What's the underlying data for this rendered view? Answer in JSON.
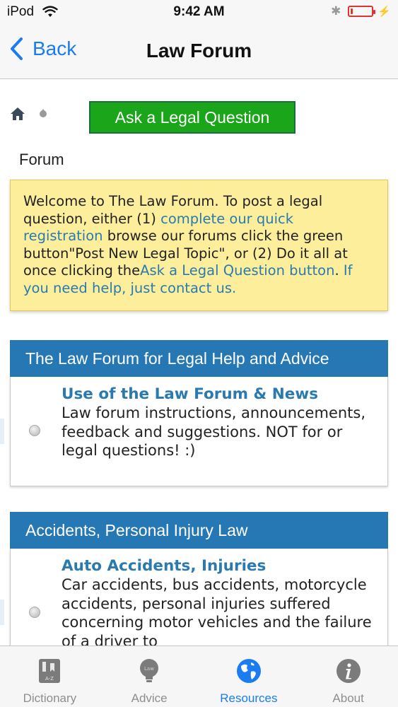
{
  "status_bar": {
    "carrier": "iPod",
    "time": "9:42 AM",
    "icons": [
      "wifi-icon",
      "bluetooth-icon",
      "battery-icon",
      "charging-icon"
    ],
    "battery_level": 0.12
  },
  "nav": {
    "back_label": "Back",
    "title": "Law Forum"
  },
  "breadcrumb": {
    "icons": [
      "home-icon",
      "bullet-icon"
    ]
  },
  "ask_button": "Ask a Legal Question",
  "page_title": "Forum",
  "notice": {
    "text_1": "Welcome to The Law Forum. To post a legal question, either (1) ",
    "link_registration": "complete our quick registration",
    "text_2": " browse our forums click the green button\"Post New Legal Topic\", or (2) Do it all at once clicking the",
    "link_ask": "Ask a Legal Question button",
    "text_3": ". ",
    "link_help": "If you need help, just contact us."
  },
  "sections": [
    {
      "header": "The Law Forum for Legal Help and Advice",
      "forum_title": "Use of the Law Forum & News",
      "forum_desc": "Law forum instructions, announcements, feedback and suggestions. NOT for or legal questions! :)"
    },
    {
      "header": "Accidents, Personal Injury Law",
      "forum_title": "Auto Accidents, Injuries",
      "forum_desc": "Car accidents, bus accidents, motorcycle accidents, personal injuries suffered concerning motor vehicles and the failure of a driver to"
    }
  ],
  "tabs": [
    {
      "label": "Dictionary",
      "icon": "dictionary-icon",
      "active": false
    },
    {
      "label": "Advice",
      "icon": "lightbulb-icon",
      "active": false,
      "icon_text": "Law"
    },
    {
      "label": "Resources",
      "icon": "globe-icon",
      "active": true
    },
    {
      "label": "About",
      "icon": "info-icon",
      "active": false
    }
  ],
  "colors": {
    "ios_blue": "#1a7cf0",
    "ask_button_green": "#1aa51a",
    "section_header_blue": "#2678b4",
    "link_blue": "#2a7ab0",
    "notice_yellow": "#fcee9a",
    "battery_red": "#e0322e"
  }
}
